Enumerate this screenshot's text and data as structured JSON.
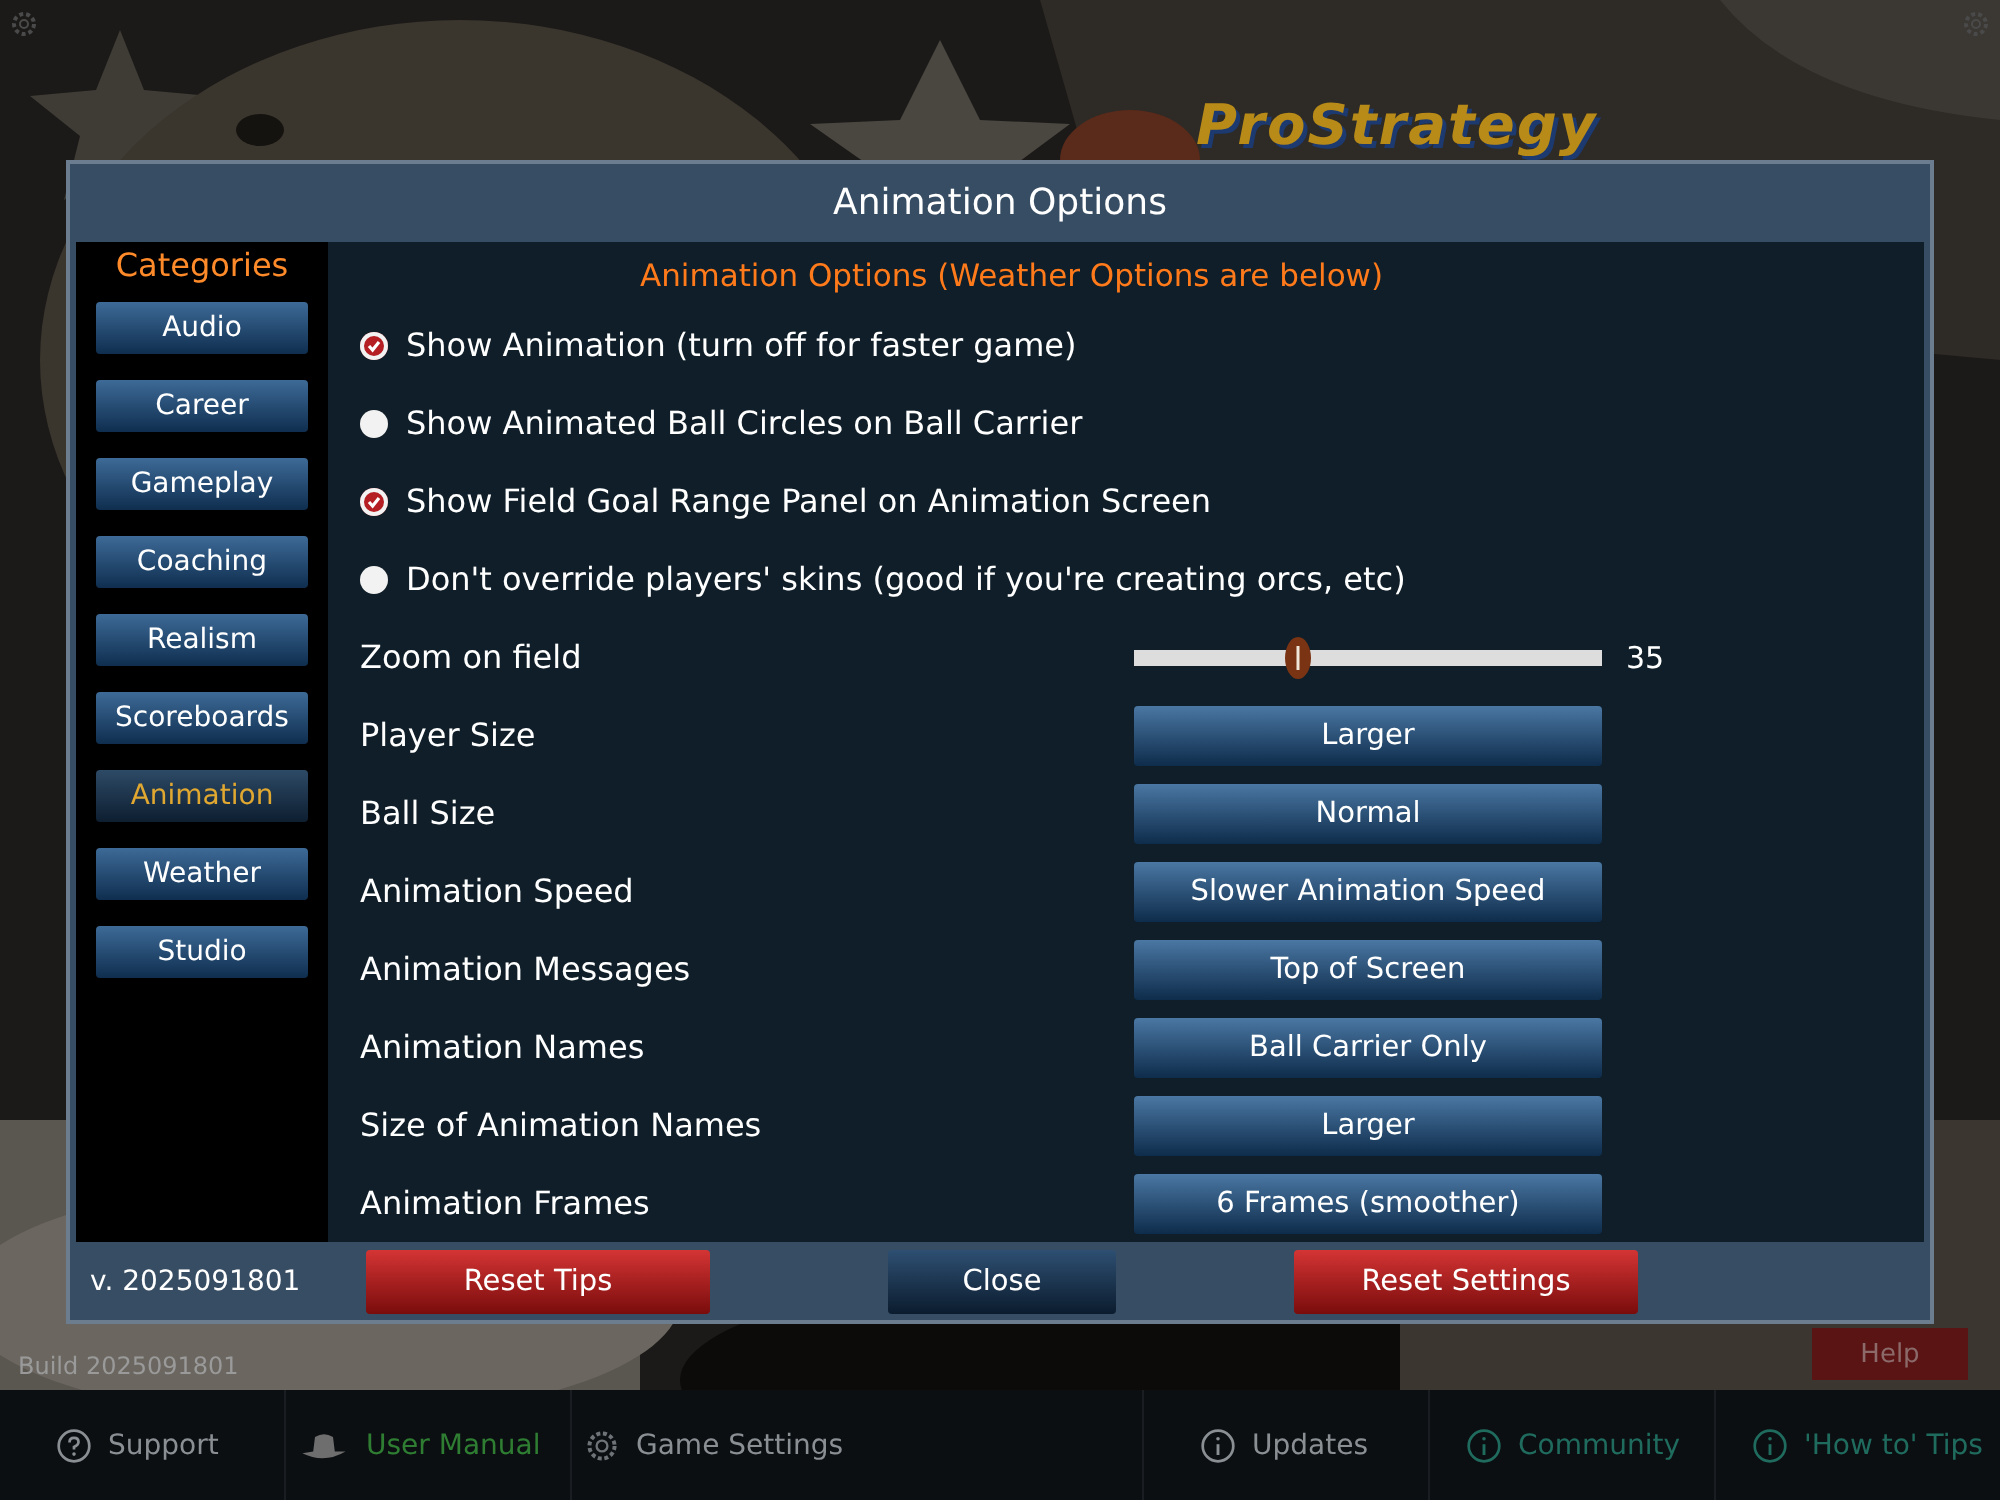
{
  "logo": "ProStrategy",
  "dialog": {
    "title": "Animation Options",
    "categories_title": "Categories",
    "categories": [
      {
        "label": "Audio",
        "selected": false
      },
      {
        "label": "Career",
        "selected": false
      },
      {
        "label": "Gameplay",
        "selected": false
      },
      {
        "label": "Coaching",
        "selected": false
      },
      {
        "label": "Realism",
        "selected": false
      },
      {
        "label": "Scoreboards",
        "selected": false
      },
      {
        "label": "Animation",
        "selected": true
      },
      {
        "label": "Weather",
        "selected": false
      },
      {
        "label": "Studio",
        "selected": false
      }
    ],
    "heading": "Animation Options (Weather Options are below)",
    "options": [
      {
        "kind": "check",
        "label": "Show Animation (turn off for faster game)",
        "checked": true
      },
      {
        "kind": "check",
        "label": "Show Animated Ball Circles on Ball Carrier",
        "checked": false
      },
      {
        "kind": "check",
        "label": "Show Field Goal Range Panel on Animation Screen",
        "checked": true
      },
      {
        "kind": "check",
        "label": "Don't override players' skins (good if you're creating orcs, etc)",
        "checked": false
      },
      {
        "kind": "slider",
        "label": "Zoom on field",
        "level": 0.35,
        "reading": "35"
      },
      {
        "kind": "select",
        "label": "Player Size",
        "value": "Larger"
      },
      {
        "kind": "select",
        "label": "Ball Size",
        "value": "Normal"
      },
      {
        "kind": "select",
        "label": "Animation Speed",
        "value": "Slower Animation Speed"
      },
      {
        "kind": "select",
        "label": "Animation Messages",
        "value": "Top of Screen"
      },
      {
        "kind": "select",
        "label": "Animation Names",
        "value": "Ball Carrier Only"
      },
      {
        "kind": "select",
        "label": "Size of Animation Names",
        "value": "Larger"
      },
      {
        "kind": "select",
        "label": "Animation Frames",
        "value": "6 Frames (smoother)"
      }
    ],
    "version": "v. 2025091801",
    "buttons": [
      {
        "label": "Reset Tips",
        "kind": "danger"
      },
      {
        "label": "Close",
        "kind": "plain"
      },
      {
        "label": "Reset Settings",
        "kind": "danger"
      }
    ]
  },
  "help": "Help",
  "build": "Build 2025091801",
  "bottom_bar": [
    {
      "label": "Support",
      "kind": "support",
      "color": "#8a8f94"
    },
    {
      "label": "User Manual",
      "kind": "manual",
      "color": "#2e7d32"
    },
    {
      "label": "Game Settings",
      "kind": "settings",
      "color": "#8a8f94"
    },
    {
      "label": "Updates",
      "kind": "info",
      "color": "#8a8f94"
    },
    {
      "label": "Community",
      "kind": "info",
      "color": "#1f6b5e"
    },
    {
      "label": "'How to' Tips",
      "kind": "info",
      "color": "#1f6b5e"
    }
  ]
}
